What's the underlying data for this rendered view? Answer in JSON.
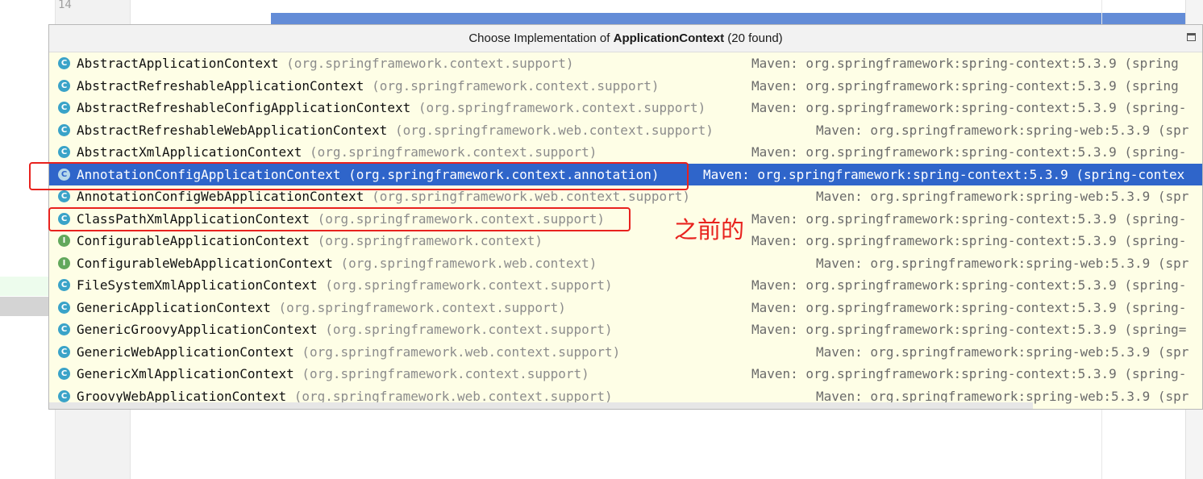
{
  "editor": {
    "line_number": "14"
  },
  "popup": {
    "title_prefix": "Choose Implementation of ",
    "title_class": "ApplicationContext",
    "title_suffix": " (20 found)",
    "items": [
      {
        "icon": "C",
        "kind": "class",
        "name": "AbstractApplicationContext",
        "package": "(org.springframework.context.support)",
        "maven": "Maven: org.springframework:spring-context:5.3.9 (spring"
      },
      {
        "icon": "C",
        "kind": "class",
        "name": "AbstractRefreshableApplicationContext",
        "package": "(org.springframework.context.support)",
        "maven": "Maven: org.springframework:spring-context:5.3.9 (spring"
      },
      {
        "icon": "C",
        "kind": "class",
        "name": "AbstractRefreshableConfigApplicationContext",
        "package": "(org.springframework.context.support)",
        "maven": "Maven: org.springframework:spring-context:5.3.9 (spring-"
      },
      {
        "icon": "C",
        "kind": "class",
        "name": "AbstractRefreshableWebApplicationContext",
        "package": "(org.springframework.web.context.support)",
        "maven": "Maven: org.springframework:spring-web:5.3.9 (spr"
      },
      {
        "icon": "C",
        "kind": "class",
        "name": "AbstractXmlApplicationContext",
        "package": "(org.springframework.context.support)",
        "maven": "Maven: org.springframework:spring-context:5.3.9 (spring-"
      },
      {
        "icon": "C",
        "kind": "class",
        "name": "AnnotationConfigApplicationContext",
        "package": "(org.springframework.context.annotation)",
        "maven": "Maven: org.springframework:spring-context:5.3.9 (spring-contex",
        "selected": true
      },
      {
        "icon": "C",
        "kind": "class",
        "name": "AnnotationConfigWebApplicationContext",
        "package": "(org.springframework.web.context.support)",
        "maven": "Maven: org.springframework:spring-web:5.3.9 (spr"
      },
      {
        "icon": "C",
        "kind": "class",
        "name": "ClassPathXmlApplicationContext",
        "package": "(org.springframework.context.support)",
        "maven": "Maven: org.springframework:spring-context:5.3.9 (spring-"
      },
      {
        "icon": "I",
        "kind": "interface",
        "name": "ConfigurableApplicationContext",
        "package": "(org.springframework.context)",
        "maven": "Maven: org.springframework:spring-context:5.3.9 (spring-"
      },
      {
        "icon": "I",
        "kind": "interface",
        "name": "ConfigurableWebApplicationContext",
        "package": "(org.springframework.web.context)",
        "maven": "Maven: org.springframework:spring-web:5.3.9 (spr"
      },
      {
        "icon": "C",
        "kind": "class",
        "name": "FileSystemXmlApplicationContext",
        "package": "(org.springframework.context.support)",
        "maven": "Maven: org.springframework:spring-context:5.3.9 (spring-"
      },
      {
        "icon": "C",
        "kind": "class",
        "name": "GenericApplicationContext",
        "package": "(org.springframework.context.support)",
        "maven": "Maven: org.springframework:spring-context:5.3.9 (spring-"
      },
      {
        "icon": "C",
        "kind": "class",
        "name": "GenericGroovyApplicationContext",
        "package": "(org.springframework.context.support)",
        "maven": "Maven: org.springframework:spring-context:5.3.9 (spring="
      },
      {
        "icon": "C",
        "kind": "class",
        "name": "GenericWebApplicationContext",
        "package": "(org.springframework.web.context.support)",
        "maven": "Maven: org.springframework:spring-web:5.3.9 (spr"
      },
      {
        "icon": "C",
        "kind": "class",
        "name": "GenericXmlApplicationContext",
        "package": "(org.springframework.context.support)",
        "maven": "Maven: org.springframework:spring-context:5.3.9 (spring-"
      },
      {
        "icon": "C",
        "kind": "class",
        "name": "GroovyWebApplicationContext",
        "package": "(org.springframework.web.context.support)",
        "maven": "Maven: org.springframework:spring-web:5.3.9 (spr"
      }
    ]
  },
  "annotation": {
    "text": "之前的",
    "color": "#e8221e"
  },
  "colors": {
    "selection": "#2f65ca",
    "popup_background": "#fefee6",
    "class_icon": "#3aa3c8",
    "interface_icon": "#62a85c"
  }
}
